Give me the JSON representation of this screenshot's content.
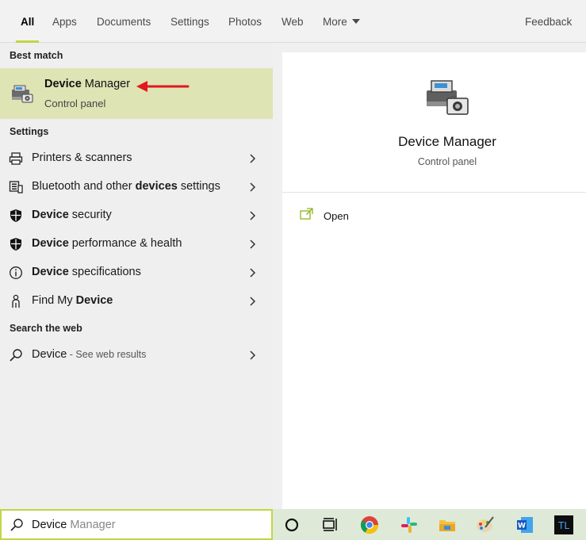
{
  "tabs": [
    {
      "label": "All",
      "active": true
    },
    {
      "label": "Apps"
    },
    {
      "label": "Documents"
    },
    {
      "label": "Settings"
    },
    {
      "label": "Photos"
    },
    {
      "label": "Web"
    },
    {
      "label": "More"
    }
  ],
  "feedback": "Feedback",
  "sections": {
    "best_match": "Best match",
    "settings": "Settings",
    "search_web": "Search the web"
  },
  "best_match": {
    "title_bold": "Device",
    "title_rest": " Manager",
    "subtitle": "Control panel",
    "icon": "device-manager-icon"
  },
  "settings_items": [
    {
      "icon": "printer-icon",
      "pre": "Printers & scanners",
      "bold": "",
      "post": ""
    },
    {
      "icon": "bluetooth-devices-icon",
      "pre": "Bluetooth and other ",
      "bold": "devices",
      "post": " settings"
    },
    {
      "icon": "shield-icon",
      "pre": "",
      "bold": "Device",
      "post": " security"
    },
    {
      "icon": "shield-icon",
      "pre": "",
      "bold": "Device",
      "post": " performance & health"
    },
    {
      "icon": "info-icon",
      "pre": "",
      "bold": "Device",
      "post": " specifications"
    },
    {
      "icon": "person-location-icon",
      "pre": "Find My ",
      "bold": "Device",
      "post": ""
    }
  ],
  "web_item": {
    "query": "Device",
    "suffix": " - See web results",
    "icon": "search-icon"
  },
  "right_panel": {
    "title": "Device Manager",
    "subtitle": "Control panel",
    "open_label": "Open"
  },
  "search": {
    "typed": "Device",
    "hint": " Manager"
  },
  "taskbar": [
    "cortana-icon",
    "task-view-icon",
    "chrome-icon",
    "slack-icon",
    "file-explorer-icon",
    "paint-icon",
    "word-icon",
    "tl-app-icon"
  ],
  "colors": {
    "accent": "#c3d545",
    "best_match_bg": "#dee4b4",
    "arrow": "#e0191e"
  }
}
